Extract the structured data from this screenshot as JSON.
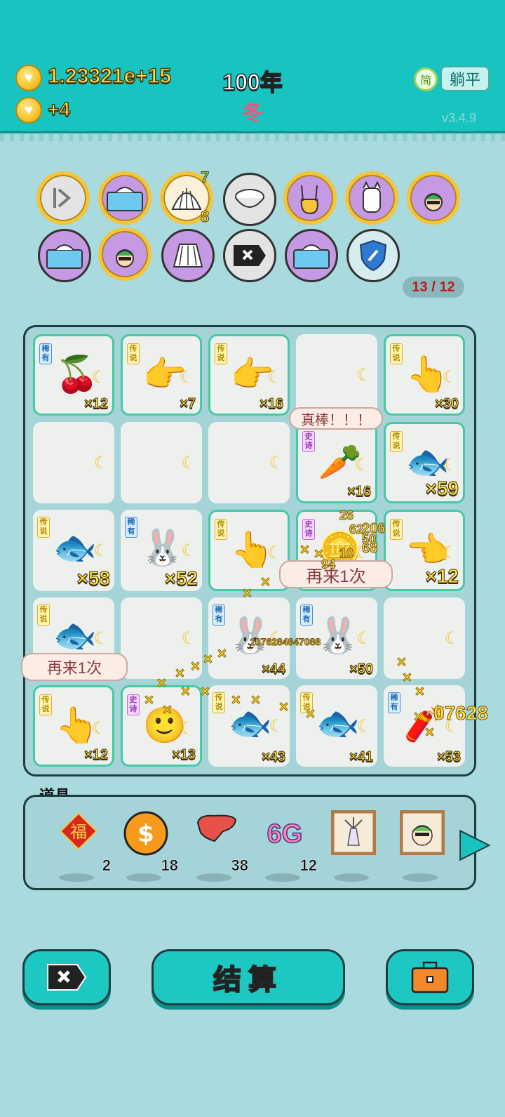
{
  "header": {
    "coins_total": "1.23321e+15",
    "coins_gain": "+4",
    "year": "100年",
    "season": "冬",
    "lang_label": "简",
    "flat_label": "躺平",
    "version": "v3.4.9"
  },
  "buffs": {
    "shell_top_badge": "7",
    "shell_bottom_badge": "8",
    "slot_count": "13 / 12"
  },
  "board": {
    "cells": [
      {
        "tag": "稀有",
        "mult": "×12"
      },
      {
        "tag": "传说",
        "mult": "×7"
      },
      {
        "tag": "传说",
        "mult": "×16"
      },
      {
        "tag": "",
        "mult": ""
      },
      {
        "tag": "传说",
        "mult": "×30"
      },
      {
        "tag": "",
        "mult": ""
      },
      {
        "tag": "",
        "mult": ""
      },
      {
        "tag": "",
        "mult": ""
      },
      {
        "tag": "史诗",
        "mult": "×16"
      },
      {
        "tag": "传说",
        "mult": "×59"
      },
      {
        "tag": "传说",
        "mult": "×58"
      },
      {
        "tag": "稀有",
        "mult": "×52"
      },
      {
        "tag": "传说",
        "mult": ""
      },
      {
        "tag": "史诗",
        "mult": ""
      },
      {
        "tag": "传说",
        "mult": "×12"
      },
      {
        "tag": "传说",
        "mult": ""
      },
      {
        "tag": "",
        "mult": ""
      },
      {
        "tag": "稀有",
        "mult": "×44"
      },
      {
        "tag": "稀有",
        "mult": "×50"
      },
      {
        "tag": "",
        "mult": ""
      },
      {
        "tag": "传说",
        "mult": "×12"
      },
      {
        "tag": "史诗",
        "mult": "×13"
      },
      {
        "tag": "传说",
        "mult": "×43"
      },
      {
        "tag": "传说",
        "mult": "×41"
      },
      {
        "tag": "稀有",
        "mult": "×53"
      }
    ],
    "bubble_great": "真棒！！！",
    "bubble_again": "再来1次",
    "float_big_a": "1076284847088",
    "float_big_b": "07628",
    "float_small": [
      "26",
      "206",
      "68",
      "94",
      "10",
      "62",
      "50"
    ]
  },
  "props": {
    "label": "道具",
    "items": [
      {
        "icon": "fu-icon",
        "qty": "2"
      },
      {
        "icon": "dollar-coin-icon",
        "qty": "18"
      },
      {
        "icon": "liver-icon",
        "qty": "38"
      },
      {
        "icon": "6g-icon",
        "qty": "12"
      },
      {
        "icon": "windmill-frame-icon",
        "qty": ""
      },
      {
        "icon": "portrait-frame-icon",
        "qty": ""
      }
    ],
    "six_g_text": "6G"
  },
  "actions": {
    "settle_label": "结算"
  },
  "colors": {
    "top_bar": "#17c4c0",
    "background": "#a9dade",
    "accent_yellow": "#ffe14d",
    "season_pink": "#ff4f7b"
  }
}
